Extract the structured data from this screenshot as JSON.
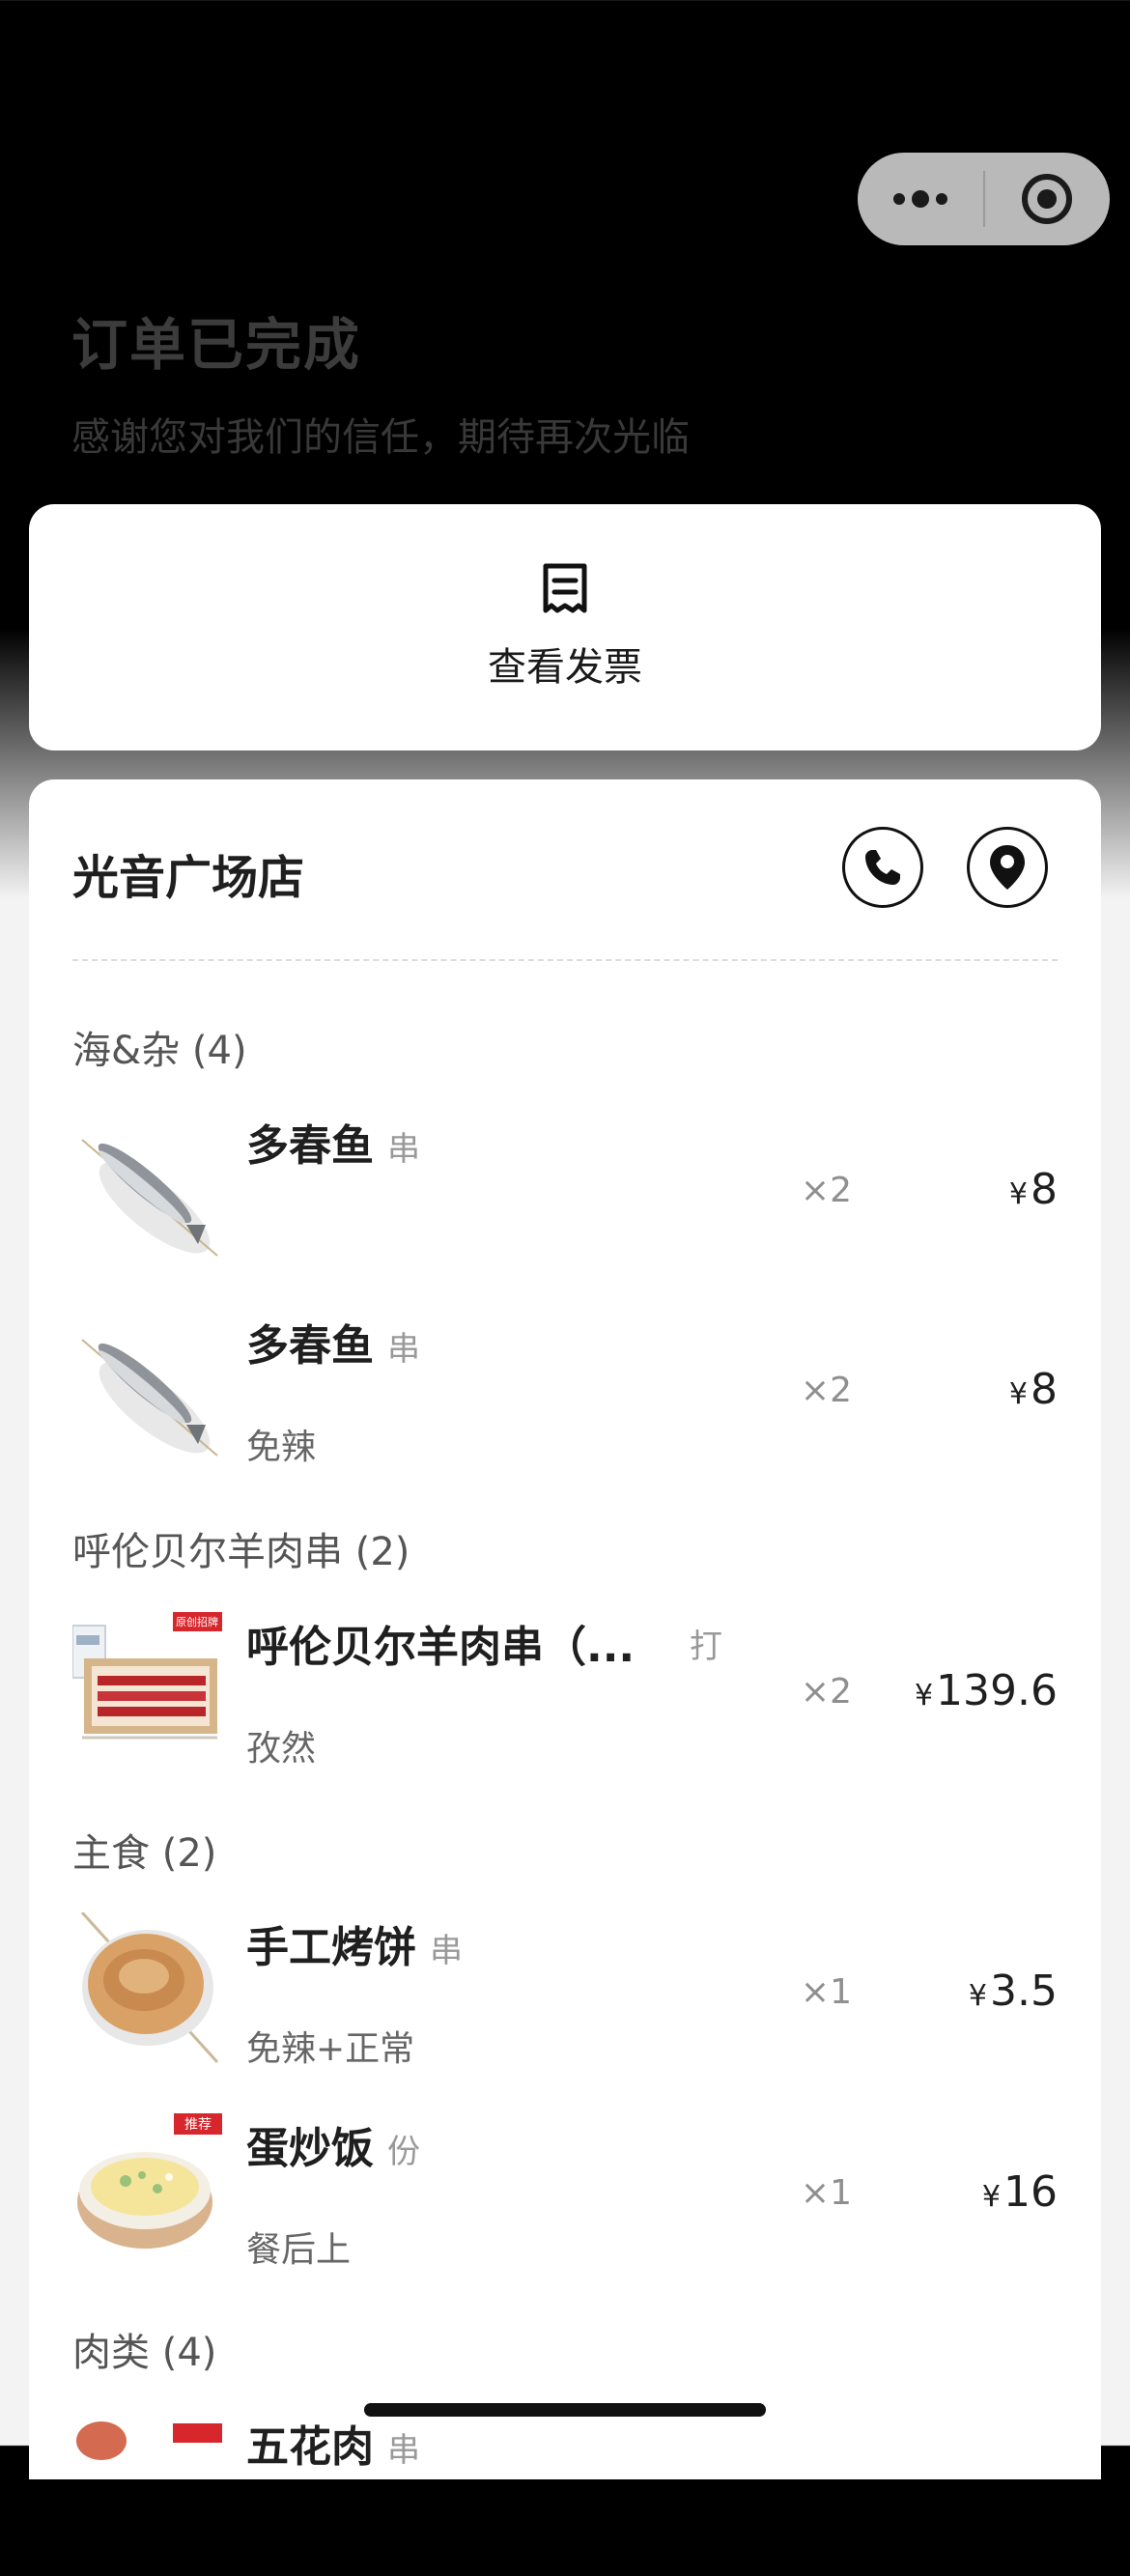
{
  "header": {
    "status_title": "订单已完成",
    "thanks_text": "感谢您对我们的信任，期待再次光临"
  },
  "capsule": {
    "more_icon": "more-dots-icon",
    "close_icon": "target-circle-icon"
  },
  "invoice": {
    "icon": "receipt-icon",
    "label": "查看发票"
  },
  "store": {
    "name": "光音广场店",
    "phone_icon": "phone-icon",
    "location_icon": "location-pin-icon"
  },
  "categories": [
    {
      "label": "海&杂 (4)"
    },
    {
      "label": "呼伦贝尔羊肉串 (2)"
    },
    {
      "label": "主食 (2)"
    },
    {
      "label": "肉类 (4)"
    }
  ],
  "items": [
    {
      "name": "多春鱼",
      "unit": "串",
      "note": "",
      "qty": "×2",
      "currency": "¥",
      "price": "8",
      "image": "fish-skewer-image"
    },
    {
      "name": "多春鱼",
      "unit": "串",
      "note": "免辣",
      "qty": "×2",
      "currency": "¥",
      "price": "8",
      "image": "fish-skewer-image"
    },
    {
      "name": "呼伦贝尔羊肉串（...",
      "unit": "打",
      "note": "孜然",
      "qty": "×2",
      "currency": "¥",
      "price": "139.6",
      "image": "lamb-skewers-box-image"
    },
    {
      "name": "手工烤饼",
      "unit": "串",
      "note": "免辣+正常",
      "qty": "×1",
      "currency": "¥",
      "price": "3.5",
      "image": "flatbread-skewer-image"
    },
    {
      "name": "蛋炒饭",
      "unit": "份",
      "note": "餐后上",
      "qty": "×1",
      "currency": "¥",
      "price": "16",
      "image": "fried-rice-bowl-image"
    },
    {
      "name": "五花肉",
      "unit": "串",
      "note": "",
      "qty": "",
      "currency": "",
      "price": "",
      "image": "pork-belly-image"
    }
  ],
  "badges": {
    "recommend": "推荐",
    "original": "原创招牌"
  }
}
